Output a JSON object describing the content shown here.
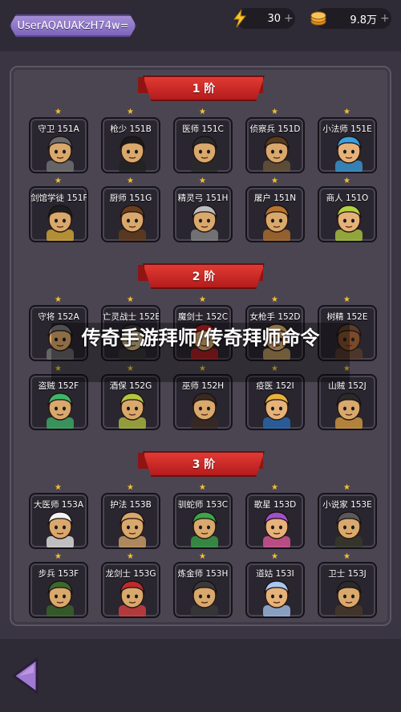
{
  "header": {
    "username": "UserAQAUAKzH74w=",
    "energy": "30",
    "gold": "9.8万",
    "plus": "+"
  },
  "tiers": [
    {
      "label": "1 阶",
      "characters": [
        {
          "name": "守卫 151A",
          "hair": "#6b6b6b",
          "skin": "#d9a86c",
          "hat": "#7a7a7a"
        },
        {
          "name": "枪少 151B",
          "hair": "#1b1b1b",
          "skin": "#d9a86c",
          "hat": "#222222"
        },
        {
          "name": "医师 151C",
          "hair": "#2a2a2a",
          "skin": "#d9a86c",
          "hat": "#2a2a2a"
        },
        {
          "name": "侦察兵 151D",
          "hair": "#5a3d1e",
          "skin": "#d9a86c",
          "hat": "#6e5a3a"
        },
        {
          "name": "小法师 151E",
          "hair": "#3aa0e0",
          "skin": "#e6b27a",
          "hat": "#3aa0e0"
        },
        {
          "name": "剑馆学徒 151F",
          "hair": "#1e1e1e",
          "skin": "#d9a86c",
          "hat": "#e0b23a"
        },
        {
          "name": "厨师 151G",
          "hair": "#6a3f1c",
          "skin": "#d9a86c",
          "hat": "#6a3f1c"
        },
        {
          "name": "精灵弓 151H",
          "hair": "#bdbdbd",
          "skin": "#d9a86c",
          "hat": "#8a8a8a"
        },
        {
          "name": "屠户 151N",
          "hair": "#b7742e",
          "skin": "#d9a86c",
          "hat": "#b7742e"
        },
        {
          "name": "商人 151O",
          "hair": "#b4d040",
          "skin": "#e6b27a",
          "hat": "#b4d040"
        }
      ]
    },
    {
      "label": "2 阶",
      "characters": [
        {
          "name": "守将 152A",
          "hair": "#7a7a7a",
          "skin": "#d9a86c",
          "hat": "#7a7a7a"
        },
        {
          "name": "亡灵战士 152B",
          "hair": "#3a3a3a",
          "skin": "#c9b48a",
          "hat": "#3a3a3a"
        },
        {
          "name": "魔剑士 152C",
          "hair": "#c81e1e",
          "skin": "#d9a86c",
          "hat": "#c81e1e"
        },
        {
          "name": "女枪手 152D",
          "hair": "#d8b16a",
          "skin": "#e6b27a",
          "hat": "#d8b16a"
        },
        {
          "name": "树精 152E",
          "hair": "#5a3d2a",
          "skin": "#7a4a2a",
          "hat": "#5a3d2a"
        },
        {
          "name": "盗贼 152F",
          "hair": "#3fb56a",
          "skin": "#d9a86c",
          "hat": "#3fb56a"
        },
        {
          "name": "酒保 152G",
          "hair": "#b5c440",
          "skin": "#d9a86c",
          "hat": "#b5c440"
        },
        {
          "name": "巫师 152H",
          "hair": "#3a2a22",
          "skin": "#d9a86c",
          "hat": "#3a2a22"
        },
        {
          "name": "疫医 152I",
          "hair": "#e8b23a",
          "skin": "#e6b27a",
          "hat": "#2a6fb8"
        },
        {
          "name": "山贼 152J",
          "hair": "#2a2a2a",
          "skin": "#d9a86c",
          "hat": "#e0a040"
        }
      ]
    },
    {
      "label": "3 阶",
      "characters": [
        {
          "name": "大医师 153A",
          "hair": "#f2f2f2",
          "skin": "#d9a86c",
          "hat": "#f2f2f2"
        },
        {
          "name": "护法 153B",
          "hair": "#d9a86c",
          "skin": "#d9a86c",
          "hat": "#d9a86c"
        },
        {
          "name": "驯蛇师 153C",
          "hair": "#3aa64a",
          "skin": "#d9a86c",
          "hat": "#3aa64a"
        },
        {
          "name": "歌星 153D",
          "hair": "#a050c8",
          "skin": "#e6b27a",
          "hat": "#e85aa0"
        },
        {
          "name": "小说家 153E",
          "hair": "#5a5a5a",
          "skin": "#d9a86c",
          "hat": "#3a3a2a"
        },
        {
          "name": "步兵 153F",
          "hair": "#3a6a2a",
          "skin": "#d9a86c",
          "hat": "#3a6a2a"
        },
        {
          "name": "龙剑士 153G",
          "hair": "#c02a2a",
          "skin": "#d9a86c",
          "hat": "#e04040"
        },
        {
          "name": "炼金师 153H",
          "hair": "#3a3a3a",
          "skin": "#d9a86c",
          "hat": "#3a3a3a"
        },
        {
          "name": "道姑 153I",
          "hair": "#a8c8f0",
          "skin": "#e6b27a",
          "hat": "#a8c8f0"
        },
        {
          "name": "卫士 153J",
          "hair": "#2a2a2a",
          "skin": "#d9a86c",
          "hat": "#4a3a2a"
        }
      ]
    }
  ],
  "overlay": {
    "title": "传奇手游拜师/传奇拜师命令"
  },
  "colors": {
    "banner": "#d42a27",
    "star": "#f2c230",
    "user_pill": "#8d74c8"
  }
}
